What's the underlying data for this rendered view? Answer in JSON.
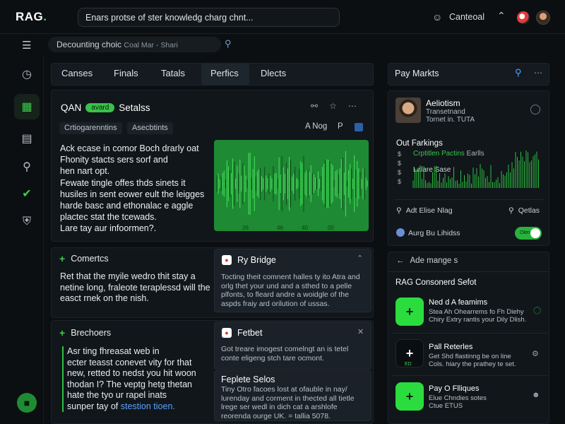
{
  "app": {
    "logo_text": "RAG",
    "logo_dot": ".",
    "prompt": "Enars protse of ster knowledg charg chnt...",
    "account_label": "Canteoal"
  },
  "toolbar": {
    "search_text": "Decounting choic",
    "search_hint": "Coal Mar - Shari"
  },
  "tabs": [
    "Canses",
    "Finals",
    "Tatals",
    "Perfics",
    "Dlects"
  ],
  "main": {
    "title": "QAN",
    "badge": "avard",
    "title_suffix": "Setalss",
    "chips": [
      "Crtiogarenntins",
      "Asecbtints"
    ],
    "chip_right": [
      "A Nog",
      "P"
    ],
    "body_lines": [
      "Ack ecase in comor Boch drarly oat",
      "Fhonity stacts sers sorf and",
      "hen nart opt.",
      "Fewate tingle offes thds sinets it",
      "husiles in sent eower eult the leigges",
      "harde basc and ethonalac e aggle",
      "plactec stat the tcewads.",
      "Lare tay aur infoormen?."
    ],
    "wave_labels": [
      "26",
      "46",
      "40",
      "00"
    ]
  },
  "comments": {
    "title": "Comertcs",
    "body_lines": [
      "Ret that the myile wedro thit stay a",
      "netine long, fraleote teraplessd will the",
      "easct rnek on the nish."
    ],
    "mini": {
      "title": "Ry Bridge",
      "body_lines": [
        "Tocting theit comnent halles ty ito Atra and",
        "orlg thet your und and a sthed to a pelle",
        "plfonts, to fleard andre a woidgle of the",
        "aspds fraiy ard orilution of ussas."
      ]
    }
  },
  "brochures": {
    "title": "Brechoers",
    "body_lines": [
      "Asr ting fhreasat web in",
      "ecter teasst conevet vity for that",
      "new, retted to nedst you hit woon",
      "thodan I? The veptg hetg thetan",
      "hate the tyo ur rapel inats",
      "sunper tay of"
    ],
    "link": "stestion tioen.",
    "mini1": {
      "title": "Fetbet",
      "body_lines": [
        "Got treare imogest comelngt an is tetel",
        "conte eligeng stch tare ocmont."
      ]
    },
    "mini2": {
      "title": "Feplete Selos",
      "body_lines": [
        "Tiny Otro facoes lost at ofauble in nay/",
        "lurenday and corment in thected all tietle",
        "lrege ser wedl in dich cat a arshlofe",
        "reorenda ourge UK.  =  tallia 5078."
      ]
    }
  },
  "right": {
    "header": "Pay Markts",
    "profile_name": "Aeliotism",
    "profile_lines": [
      "Transetnand",
      "Tornet in. TUTA"
    ],
    "stats_title": "Out Farkings",
    "stats_legend": "Crptitlen Pactins",
    "stats_legend2": "Earlls",
    "stats_sub": "Lalare Sase",
    "y_ticks": [
      "$",
      "$",
      "$",
      "$"
    ],
    "action_left": "Adt Elise Nlag",
    "action_right": "Qetlas",
    "toggle_label": "Aurg Bu Lihidss",
    "toggle_text": "Olen",
    "adv_back": "Ade mange s",
    "adv_title": "RAG Consonerd Sefot",
    "items": [
      {
        "icon": "+",
        "title": "Ned d A feamims",
        "lines": [
          "Stea Ah Ohearrems fo Fh Diehy",
          "Chiry Extry rantis your Dily Dlish."
        ]
      },
      {
        "icon": "+",
        "title": "Pall Reterles",
        "lines": [
          "Get Shd flastinng be on line",
          "Cols. hiary the prathey te set."
        ],
        "sub": "ED"
      },
      {
        "icon": "+",
        "title": "Pay O Flliques",
        "lines": [
          "Elue Chndies sotes",
          "Ctue ETUS"
        ]
      }
    ]
  },
  "colors": {
    "accent": "#3ad04a",
    "bg": "#0c0f12",
    "card": "#11161a"
  }
}
